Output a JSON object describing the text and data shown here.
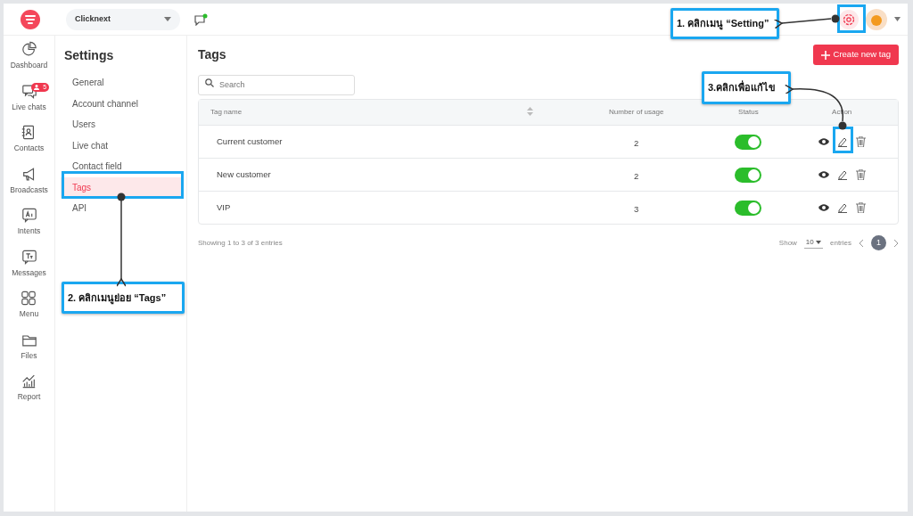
{
  "workspace": {
    "name": "Clicknext"
  },
  "nav": [
    {
      "label": "Dashboard",
      "selected": false
    },
    {
      "label": "Live chats",
      "selected": false,
      "badge": "5"
    },
    {
      "label": "Contacts",
      "selected": false
    },
    {
      "label": "Broadcasts",
      "selected": false
    },
    {
      "label": "Intents",
      "selected": false
    },
    {
      "label": "Messages",
      "selected": false
    },
    {
      "label": "Menu",
      "selected": false
    },
    {
      "label": "Files",
      "selected": false
    },
    {
      "label": "Report",
      "selected": false
    }
  ],
  "settings": {
    "title": "Settings",
    "items": [
      {
        "label": "General",
        "selected": false
      },
      {
        "label": "Account channel",
        "selected": false
      },
      {
        "label": "Users",
        "selected": false
      },
      {
        "label": "Live chat",
        "selected": false
      },
      {
        "label": "Contact field",
        "selected": false
      },
      {
        "label": "Tags",
        "selected": true
      },
      {
        "label": "API",
        "selected": false
      }
    ]
  },
  "page": {
    "title": "Tags",
    "create_button": "Create new tag",
    "search": {
      "placeholder": "Search"
    }
  },
  "table": {
    "columns": [
      "Tag name",
      "Number of usage",
      "Status",
      "Action"
    ],
    "rows": [
      {
        "name": "Current customer",
        "usage": "2",
        "on": true
      },
      {
        "name": "New customer",
        "usage": "2",
        "on": true
      },
      {
        "name": "VIP",
        "usage": "3",
        "on": true
      }
    ]
  },
  "footer": {
    "summary": "Showing 1 to 3 of 3 entries",
    "show_label": "Show",
    "page_size": "10",
    "entries_label": "entries",
    "pages": [
      {
        "label": "1",
        "selected": true
      }
    ]
  },
  "annotations": [
    {
      "text": "1. คลิกเมนู “Setting”"
    },
    {
      "text": "2. คลิกเมนูย่อย “Tags”"
    },
    {
      "text": "3.คลิกเพื่อแก้ไข"
    }
  ]
}
